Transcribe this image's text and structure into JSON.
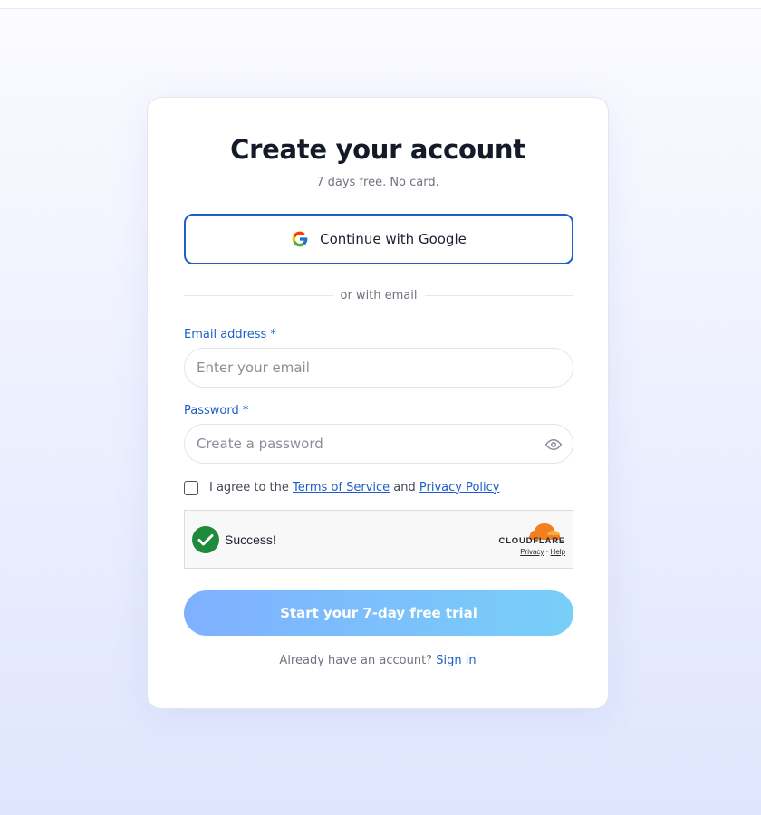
{
  "form": {
    "title": "Create your account",
    "subtitle": "7 days free. No card.",
    "google_button_label": "Continue with Google",
    "divider_text": "or with email",
    "email_label": "Email address *",
    "email_placeholder": "Enter your email",
    "email_value": "",
    "password_label": "Password *",
    "password_placeholder": "Create a password",
    "password_value": "",
    "agree_prefix": "I agree to the ",
    "terms_link": "Terms of Service",
    "agree_and": " and ",
    "privacy_link": "Privacy Policy",
    "agree_checked": false,
    "submit_label": "Start your 7-day free trial",
    "signin_prompt": "Already have an account? ",
    "signin_link": "Sign in"
  },
  "captcha": {
    "status": "Success!",
    "brand": "CLOUDFLARE",
    "privacy_link": "Privacy",
    "separator": " · ",
    "help_link": "Help"
  },
  "icons": {
    "google": "google-g-icon",
    "eye": "eye-icon",
    "check": "success-check-icon",
    "cloud": "cloudflare-cloud-icon"
  },
  "colors": {
    "accent": "#1d5fc7",
    "title": "#141a28",
    "muted": "#6f7480",
    "success": "#1e8a3c",
    "cloudflare": "#f38020",
    "button_gradient_start": "#7fb0ff",
    "button_gradient_end": "#78cff8"
  }
}
